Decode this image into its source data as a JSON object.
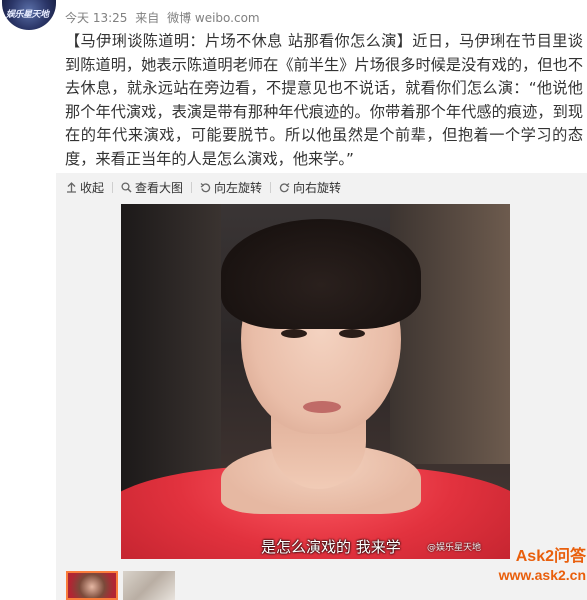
{
  "post": {
    "avatar_text": "娱乐星天地",
    "timestamp": "今天 13:25",
    "source_prefix": "来自",
    "source_name": "微博 weibo.com",
    "text": "【马伊琍谈陈道明：片场不休息 站那看你怎么演】近日，马伊琍在节目里谈到陈道明，她表示陈道明老师在《前半生》片场很多时候是没有戏的，但也不去休息，就永远站在旁边看，不提意见也不说话，就看你们怎么演：“他说他那个年代演戏，表演是带有那种年代痕迹的。你带着那个年代感的痕迹，到现在的年代来演戏，可能要脱节。所以他虽然是个前辈，但抱着一个学习的态度，来看正当年的人是怎么演戏，他来学。”"
  },
  "toolbar": {
    "collapse_label": "收起",
    "view_large_label": "查看大图",
    "rotate_left_label": "向左旋转",
    "rotate_right_label": "向右旋转"
  },
  "image": {
    "subtitle": "是怎么演戏的 我来学",
    "watermark": "@娱乐星天地"
  },
  "site_watermark": {
    "line1": "Ask2问答",
    "line2": "www.ask2.cn"
  },
  "colors": {
    "accent": "#fa7d3c",
    "watermark": "#e95f0c",
    "meta_text": "#808080",
    "media_bg": "#f2f2f2"
  }
}
